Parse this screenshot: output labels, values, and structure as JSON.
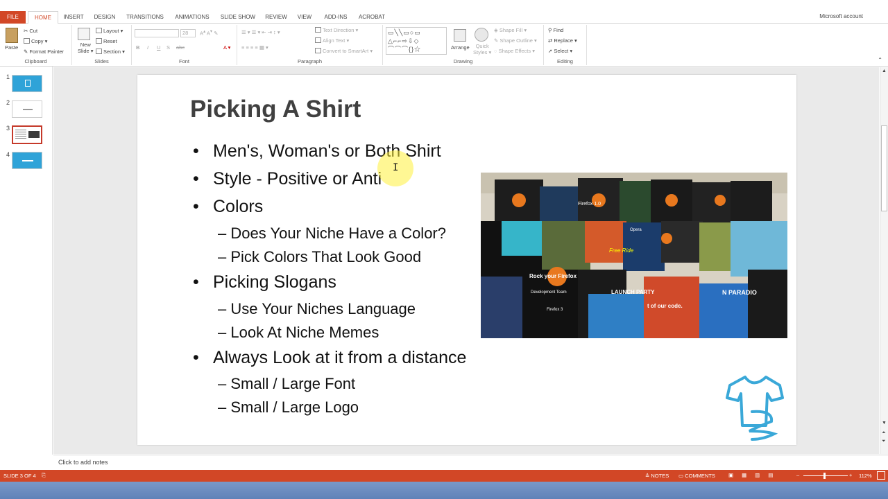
{
  "ribbon_tabs": [
    "FILE",
    "HOME",
    "INSERT",
    "DESIGN",
    "TRANSITIONS",
    "ANIMATIONS",
    "SLIDE SHOW",
    "REVIEW",
    "VIEW",
    "ADD-INS",
    "ACROBAT"
  ],
  "account": "Microsoft account",
  "clipboard": {
    "paste": "Paste",
    "cut": "Cut",
    "copy": "Copy",
    "format_painter": "Format Painter",
    "label": "Clipboard"
  },
  "slides_grp": {
    "new_slide_1": "New",
    "new_slide_2": "Slide",
    "layout": "Layout",
    "reset": "Reset",
    "section": "Section",
    "label": "Slides"
  },
  "font_grp": {
    "size": "28",
    "bold": "B",
    "italic": "I",
    "underline": "U",
    "strike": "S",
    "shadow": "abc",
    "label": "Font"
  },
  "paragraph_grp": {
    "text_direction": "Text Direction",
    "align_text": "Align Text",
    "convert": "Convert to SmartArt",
    "label": "Paragraph"
  },
  "drawing_grp": {
    "arrange": "Arrange",
    "quick_styles_1": "Quick",
    "quick_styles_2": "Styles",
    "shape_fill": "Shape Fill",
    "shape_outline": "Shape Outline",
    "shape_effects": "Shape Effects",
    "label": "Drawing"
  },
  "editing_grp": {
    "find": "Find",
    "replace": "Replace",
    "select": "Select",
    "label": "Editing"
  },
  "slide_numbers": [
    "1",
    "2",
    "3",
    "4"
  ],
  "slide": {
    "title": "Picking A Shirt",
    "bullets": [
      {
        "text": "Men's, Woman's or Both Shirt",
        "level": 1
      },
      {
        "text": "Style - Positive or Anti",
        "level": 1
      },
      {
        "text": "Colors",
        "level": 1
      },
      {
        "text": "Does Your Niche Have a Color?",
        "level": 2
      },
      {
        "text": "Pick Colors That Look Good",
        "level": 2
      },
      {
        "text": "Picking Slogans",
        "level": 1
      },
      {
        "text": "Use Your Niches Language",
        "level": 2
      },
      {
        "text": "Look At Niche Memes",
        "level": 2
      },
      {
        "text": "Always Look at it from a distance",
        "level": 1
      },
      {
        "text": "Small / Large Font",
        "level": 2
      },
      {
        "text": "Small / Large Logo",
        "level": 2
      }
    ],
    "bullet_symbol": "•",
    "sub_bullet_symbol": "–",
    "photo_texts": [
      "Firefox 1.0",
      "Free Ride",
      "Rock your Firefox",
      "Opera",
      "Development Team",
      "LAUNCH PARTY",
      "t of our code.",
      "N PARADIO",
      "Firefox 3"
    ]
  },
  "notes_placeholder": "Click to add notes",
  "status": {
    "slide_of": "SLIDE 3 OF 4",
    "notes": "NOTES",
    "comments": "COMMENTS",
    "zoom": "112%"
  },
  "colors": {
    "accent": "#d24726",
    "icon_blue": "#3aa8d8"
  }
}
